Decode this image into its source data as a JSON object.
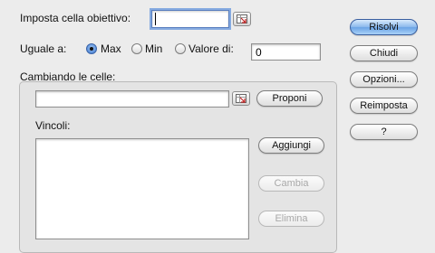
{
  "target": {
    "label": "Imposta cella obiettivo:",
    "value": "",
    "picker_icon": "cell-range-picker-icon"
  },
  "equal_to": {
    "label": "Uguale a:",
    "options": [
      {
        "label": "Max",
        "selected": true
      },
      {
        "label": "Min",
        "selected": false
      },
      {
        "label": "Valore di:",
        "selected": false
      }
    ],
    "value": "0"
  },
  "changing_cells": {
    "label": "Cambiando le celle:",
    "value": "",
    "picker_icon": "cell-range-picker-icon",
    "guess_button": "Proponi"
  },
  "constraints": {
    "label": "Vincoli:",
    "items": [],
    "buttons": {
      "add": "Aggiungi",
      "change": "Cambia",
      "delete": "Elimina"
    }
  },
  "side_buttons": {
    "solve": "Risolvi",
    "close": "Chiudi",
    "options": "Opzioni...",
    "reset": "Reimposta",
    "help": "?"
  },
  "colors": {
    "default_button": "#6aa3e6",
    "focus_ring": "#6394dc",
    "dialog_bg": "#ececec"
  }
}
